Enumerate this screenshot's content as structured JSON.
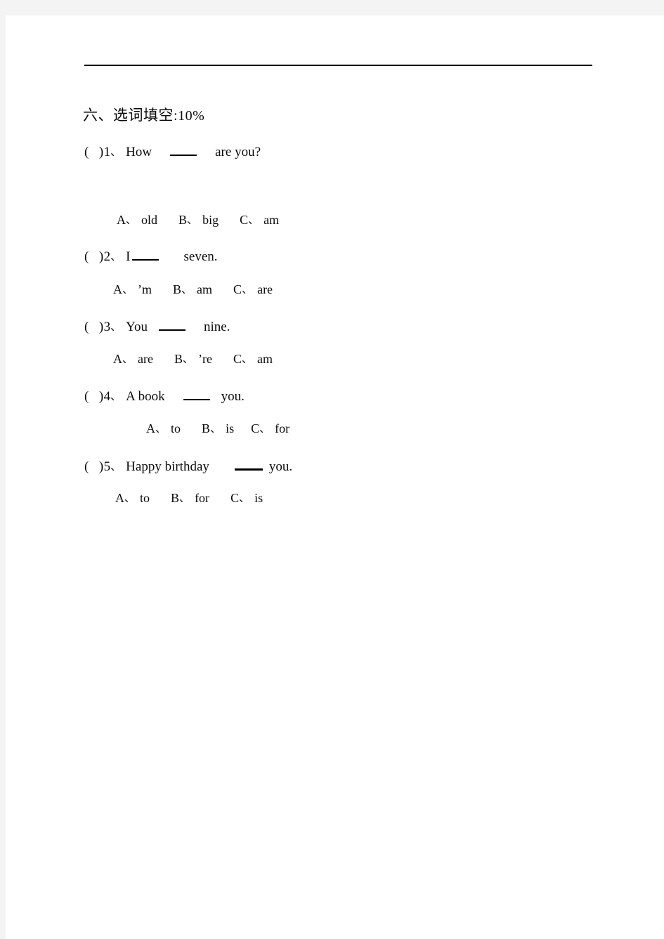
{
  "page": {
    "background_color": "#ffffff",
    "band_color": "#f4f4f4",
    "text_color": "#0a0a0a"
  },
  "section": {
    "number_cjk": "六、",
    "title_cjk": "选词填空",
    "colon": ":",
    "score": "10%",
    "full_title": "六、选词填空:10%"
  },
  "questions": [
    {
      "marker_open": "(",
      "marker_close": ")",
      "number": "1",
      "enumerator_tick": "、",
      "text_before": "How",
      "text_after": "are  you?",
      "options": [
        {
          "letter": "A",
          "tick": "、",
          "value": "old"
        },
        {
          "letter": "B",
          "tick": "、",
          "value": "big"
        },
        {
          "letter": "C",
          "tick": "、",
          "value": "am"
        }
      ]
    },
    {
      "marker_open": "(",
      "marker_close": ")",
      "number": "2",
      "enumerator_tick": "、",
      "text_before": "I",
      "text_after": "seven.",
      "options": [
        {
          "letter": "A",
          "tick": "、",
          "value": "’m"
        },
        {
          "letter": "B",
          "tick": "、",
          "value": "am"
        },
        {
          "letter": "C",
          "tick": "、",
          "value": "are"
        }
      ]
    },
    {
      "marker_open": "(",
      "marker_close": ")",
      "number": "3",
      "enumerator_tick": "、",
      "text_before": "You",
      "text_after": "nine.",
      "options": [
        {
          "letter": "A",
          "tick": "、",
          "value": "are"
        },
        {
          "letter": "B",
          "tick": "、",
          "value": "’re"
        },
        {
          "letter": "C",
          "tick": "、",
          "value": "am"
        }
      ]
    },
    {
      "marker_open": "(",
      "marker_close": ")",
      "number": "4",
      "enumerator_tick": "、",
      "text_before": "A  book",
      "text_after": "you.",
      "options": [
        {
          "letter": "A",
          "tick": "、",
          "value": "to"
        },
        {
          "letter": "B",
          "tick": "、",
          "value": "is"
        },
        {
          "letter": "C",
          "tick": "、",
          "value": "for"
        }
      ]
    },
    {
      "marker_open": "(",
      "marker_close": ")",
      "number": "5",
      "enumerator_tick": "、",
      "text_before": "Happy  birthday",
      "text_after": "you.",
      "options": [
        {
          "letter": "A",
          "tick": "、",
          "value": "to"
        },
        {
          "letter": "B",
          "tick": "、",
          "value": "for"
        },
        {
          "letter": "C",
          "tick": "、",
          "value": "is"
        }
      ]
    }
  ]
}
